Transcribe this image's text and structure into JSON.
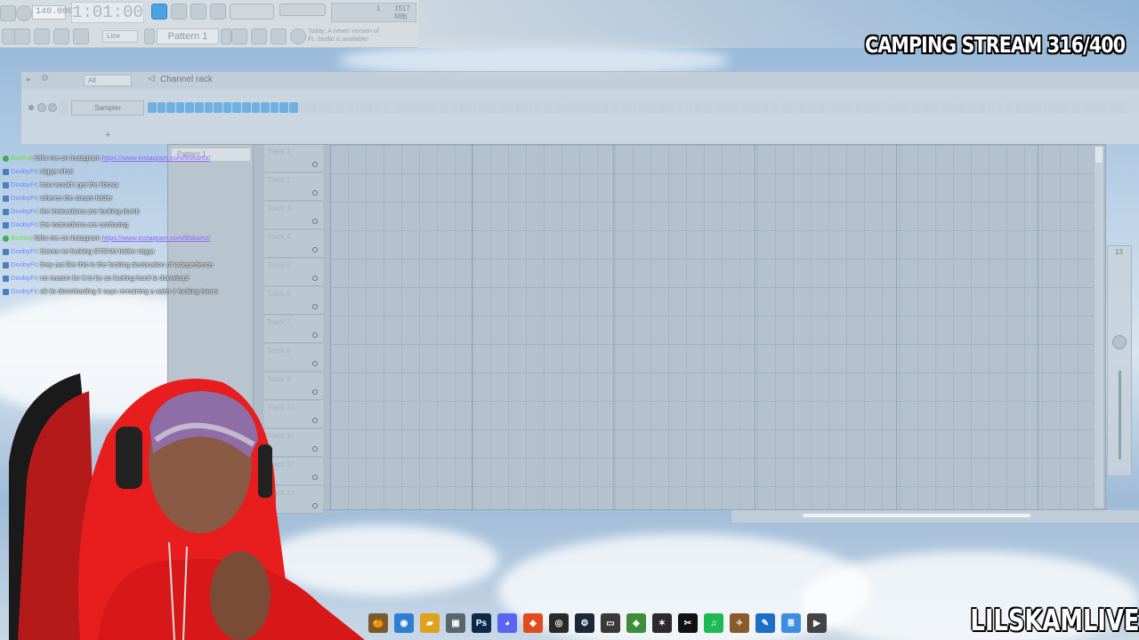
{
  "fl": {
    "tempo": "140.000",
    "time": "1:01:00",
    "cpu_top": "1",
    "ram": "1517 MB",
    "cpu_bottom": "0",
    "snap_mode": "Line",
    "pattern": "Pattern 1",
    "hint_line1": "Today: A newer version of",
    "hint_line2": "FL Studio is available!"
  },
  "stream": {
    "title": "CAMPING STREAM 316/400",
    "watermark": "LILSKAMLIVE"
  },
  "rack": {
    "filter": "All",
    "title": "Channel rack",
    "channel": "Sampler",
    "add_symbol": "+",
    "lit_steps": 16,
    "total_steps": 104
  },
  "playlist": {
    "pattern_label": "Pattern 1",
    "tracks": [
      "Track 1",
      "Track 2",
      "Track 3",
      "Track 4",
      "Track 5",
      "Track 6",
      "Track 7",
      "Track 8",
      "Track 9",
      "Track 10",
      "Track 11",
      "Track 12",
      "Track 13"
    ],
    "mixer_number": "13"
  },
  "chat": [
    {
      "user": "BotRix",
      "bot": true,
      "text": ": follw me on instagram ",
      "link": "https://www.instagram.com/lilskamz/"
    },
    {
      "user": "DoobyFr",
      "bot": false,
      "text": ": nigga what"
    },
    {
      "user": "DoobyFr",
      "bot": false,
      "text": ": how would i get the library"
    },
    {
      "user": "DoobyFr",
      "bot": false,
      "text": ": wheres the steam folder"
    },
    {
      "user": "DoobyFr",
      "bot": false,
      "text": ": the instructions are fucking dumb"
    },
    {
      "user": "DoobyFr",
      "bot": false,
      "text": ": the instructions are confusing"
    },
    {
      "user": "BotRix",
      "bot": true,
      "text": ": follw me on instagram ",
      "link": "https://www.instagram.com/lilskamz/"
    },
    {
      "user": "DoobyFr",
      "bot": false,
      "text": ": theres no fucking STEAM folder nigga"
    },
    {
      "user": "DoobyFr",
      "bot": false,
      "text": ": they act like this is the fucking declaration of indepedence"
    },
    {
      "user": "DoobyFr",
      "bot": false,
      "text": ": no reason for it to be so fucking hard to donwload"
    },
    {
      "user": "DoobyFr",
      "bot": false,
      "text": ": ok its downloading it says remaining a calm 4 fucking hours"
    }
  ],
  "taskbar": [
    {
      "icon": "fl-studio-icon",
      "glyph": "🍊",
      "color": "#7a5a2a"
    },
    {
      "icon": "chrome-icon",
      "glyph": "◉",
      "color": "#2d7fd3"
    },
    {
      "icon": "file-explorer-icon",
      "glyph": "▰",
      "color": "#e0a21b"
    },
    {
      "icon": "app-icon",
      "glyph": "▣",
      "color": "#5a6570"
    },
    {
      "icon": "photoshop-icon",
      "glyph": "Ps",
      "color": "#0b2a4a"
    },
    {
      "icon": "discord-icon",
      "glyph": "◕",
      "color": "#5865f2"
    },
    {
      "icon": "brave-icon",
      "glyph": "◆",
      "color": "#e34b1c"
    },
    {
      "icon": "obs-icon",
      "glyph": "◎",
      "color": "#2a2a2a"
    },
    {
      "icon": "steam-icon",
      "glyph": "⚙",
      "color": "#1b2838"
    },
    {
      "icon": "app-icon-2",
      "glyph": "▭",
      "color": "#3a3a3a"
    },
    {
      "icon": "layers-icon",
      "glyph": "◈",
      "color": "#3c8d3c"
    },
    {
      "icon": "app-icon-3",
      "glyph": "✶",
      "color": "#2b2b2b"
    },
    {
      "icon": "capcut-icon",
      "glyph": "✂",
      "color": "#111"
    },
    {
      "icon": "spotify-icon",
      "glyph": "♫",
      "color": "#1db954"
    },
    {
      "icon": "game-icon",
      "glyph": "✧",
      "color": "#8a5a2a"
    },
    {
      "icon": "paint-icon",
      "glyph": "✎",
      "color": "#1c6fc7"
    },
    {
      "icon": "notepad-icon",
      "glyph": "≣",
      "color": "#3d8ee0"
    },
    {
      "icon": "media-player-icon",
      "glyph": "▶",
      "color": "#444"
    }
  ]
}
